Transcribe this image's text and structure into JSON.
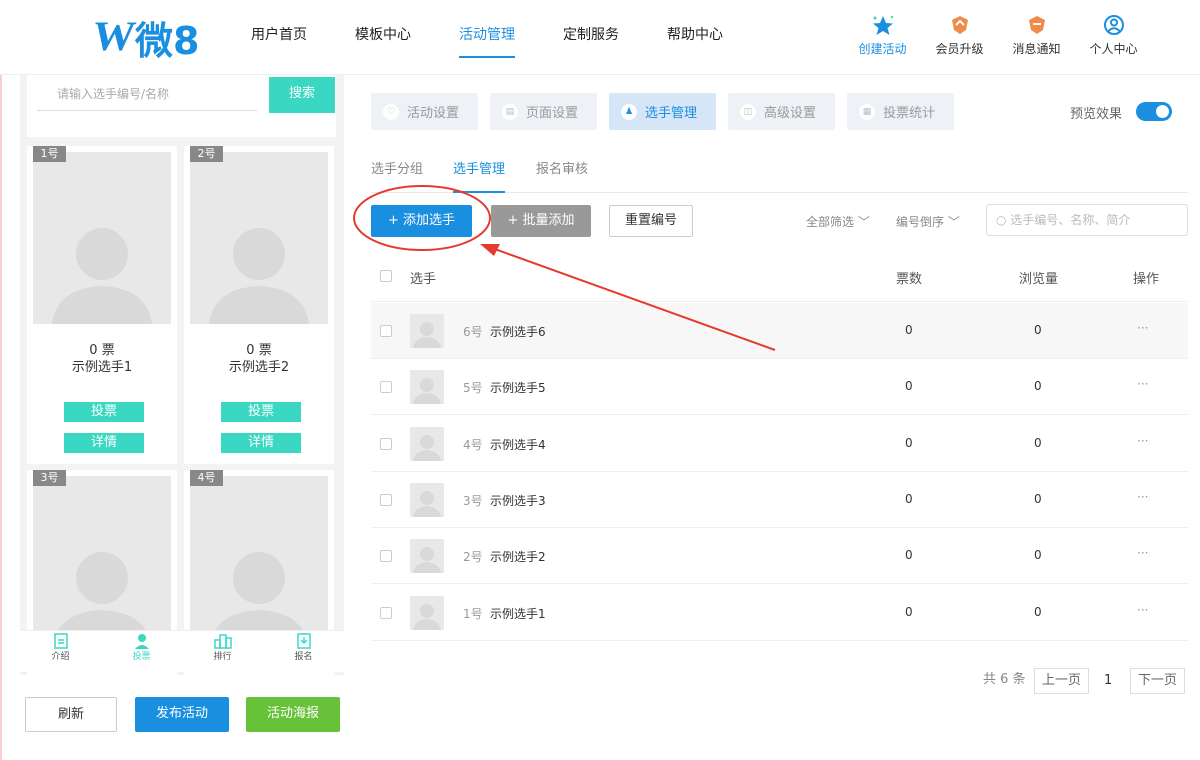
{
  "header": {
    "logo_w": "W",
    "logo_text": "微8",
    "nav": [
      "用户首页",
      "模板中心",
      "活动管理",
      "定制服务",
      "帮助中心"
    ],
    "right": [
      "创建活动",
      "会员升级",
      "消息通知",
      "个人中心"
    ]
  },
  "preview": {
    "search_placeholder": "请输入选手编号/名称",
    "search_button": "搜索",
    "cards": [
      {
        "num": "1号",
        "votes": "0 票",
        "name": "示例选手1",
        "vote_btn": "投票",
        "detail_btn": "详情"
      },
      {
        "num": "2号",
        "votes": "0 票",
        "name": "示例选手2",
        "vote_btn": "投票",
        "detail_btn": "详情"
      },
      {
        "num": "3号"
      },
      {
        "num": "4号"
      }
    ],
    "tabs": [
      "介绍",
      "投票",
      "排行",
      "报名"
    ]
  },
  "left_buttons": {
    "refresh": "刷新",
    "publish": "发布活动",
    "poster": "活动海报"
  },
  "steps": [
    "活动设置",
    "页面设置",
    "选手管理",
    "高级设置",
    "投票统计"
  ],
  "preview_toggle": "预览效果",
  "subtabs": [
    "选手分组",
    "选手管理",
    "报名审核"
  ],
  "actions": {
    "add": "+ 添加选手",
    "batch": "+ 批量添加",
    "reset": "重置编号"
  },
  "filters": {
    "all": "全部筛选 ﹀",
    "order": "编号倒序 ﹀"
  },
  "table_search_placeholder": "选手编号、名称、简介",
  "table": {
    "headers": [
      "选手",
      "票数",
      "浏览量",
      "操作"
    ],
    "rows": [
      {
        "num": "6号",
        "name": "示例选手6",
        "votes": "0",
        "views": "0",
        "op": "···"
      },
      {
        "num": "5号",
        "name": "示例选手5",
        "votes": "0",
        "views": "0",
        "op": "···"
      },
      {
        "num": "4号",
        "name": "示例选手4",
        "votes": "0",
        "views": "0",
        "op": "···"
      },
      {
        "num": "3号",
        "name": "示例选手3",
        "votes": "0",
        "views": "0",
        "op": "···"
      },
      {
        "num": "2号",
        "name": "示例选手2",
        "votes": "0",
        "views": "0",
        "op": "···"
      },
      {
        "num": "1号",
        "name": "示例选手1",
        "votes": "0",
        "views": "0",
        "op": "···"
      }
    ]
  },
  "pagination": {
    "total": "共 6 条",
    "prev": "上一页",
    "page": "1",
    "next": "下一页"
  },
  "colors": {
    "accent": "#1a8fe0",
    "teal": "#3ad8c3",
    "green": "#67c23a",
    "annotation": "#e53a2f"
  }
}
